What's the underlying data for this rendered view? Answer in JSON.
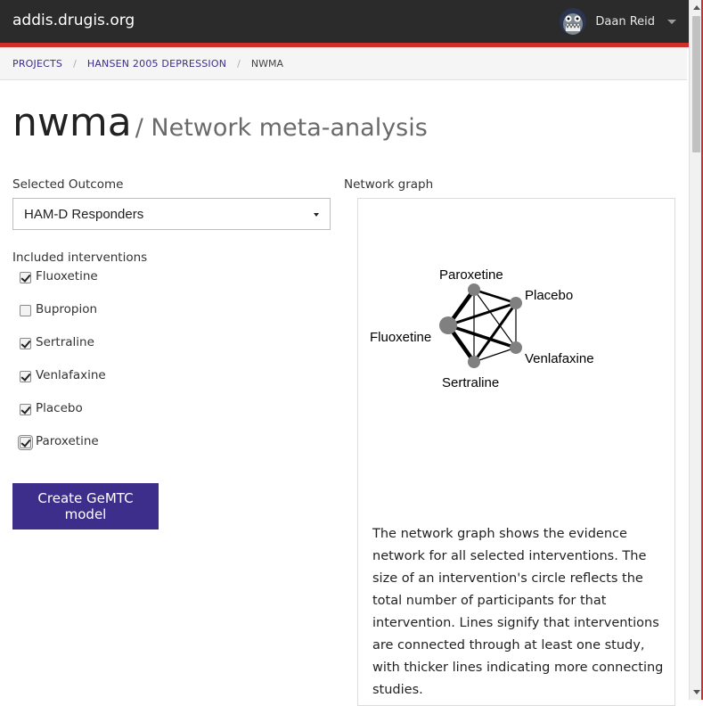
{
  "app": {
    "brand": "addis.drugis.org",
    "user_name": "Daan Reid",
    "accent_color": "#d0302b",
    "primary_color": "#3e2e8c"
  },
  "breadcrumb": {
    "items": [
      "PROJECTS",
      "HANSEN 2005 DEPRESSION"
    ],
    "separator": "/",
    "current": "NWMA"
  },
  "page": {
    "title": "nwma",
    "subtitle": "/ Network meta-analysis"
  },
  "outcome": {
    "label": "Selected Outcome",
    "selected": "HAM-D Responders"
  },
  "interventions": {
    "label": "Included interventions",
    "items": [
      {
        "label": "Fluoxetine",
        "checked": true
      },
      {
        "label": "Bupropion",
        "checked": false
      },
      {
        "label": "Sertraline",
        "checked": true
      },
      {
        "label": "Venlafaxine",
        "checked": true
      },
      {
        "label": "Placebo",
        "checked": true
      },
      {
        "label": "Paroxetine",
        "checked": true
      }
    ]
  },
  "create_button": "Create GeMTC model",
  "network": {
    "label": "Network graph",
    "nodes": {
      "paroxetine": "Paroxetine",
      "placebo": "Placebo",
      "fluoxetine": "Fluoxetine",
      "venlafaxine": "Venlafaxine",
      "sertraline": "Sertraline"
    },
    "description": "The network graph shows the evidence network for all selected interventions. The size of an intervention's circle reflects the total number of participants for that intervention. Lines signify that interventions are connected through at least one study, with thicker lines indicating more connecting studies."
  }
}
